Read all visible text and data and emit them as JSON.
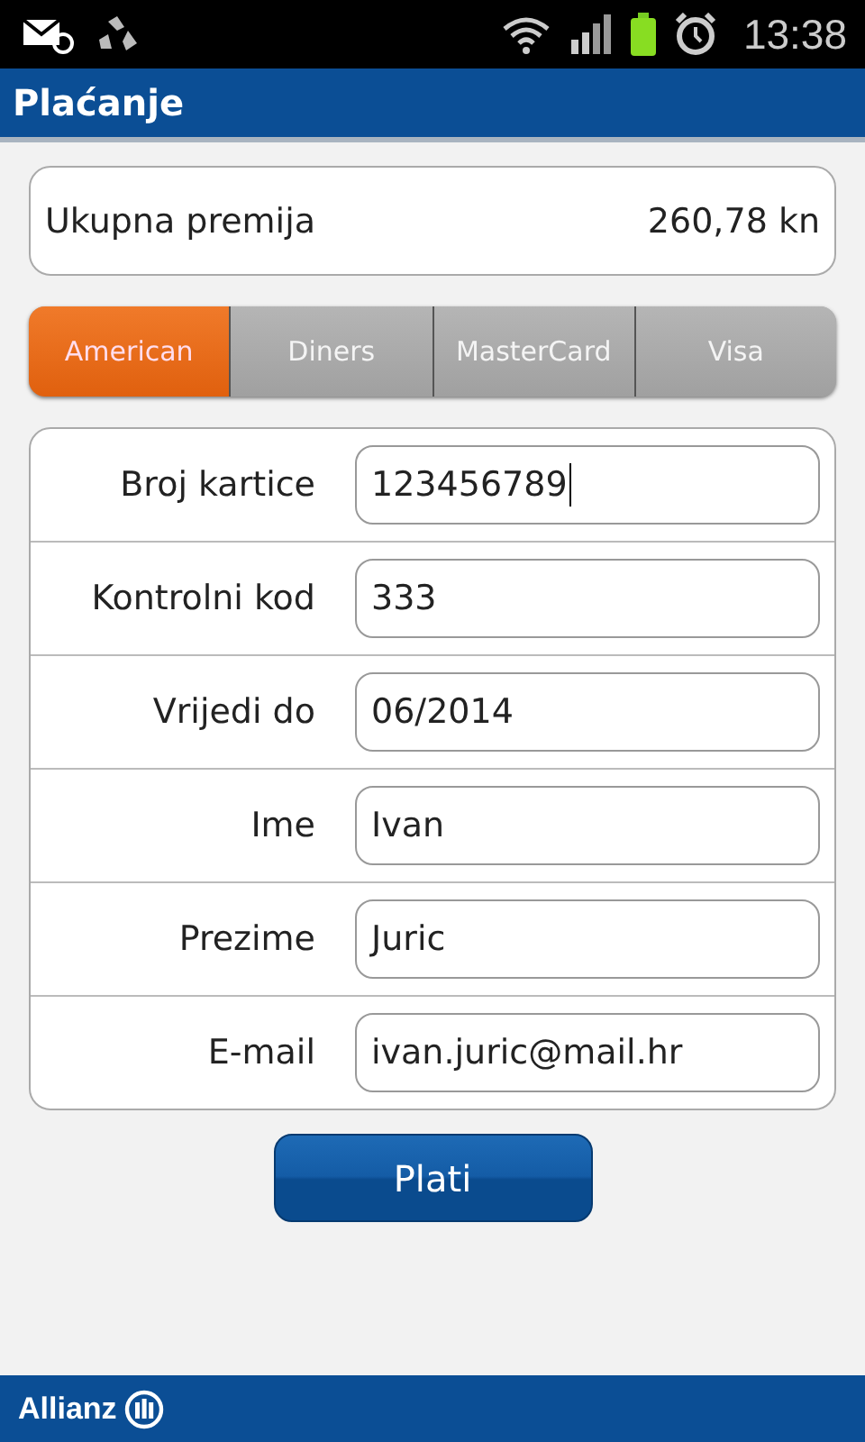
{
  "status_bar": {
    "time": "13:38"
  },
  "title_bar": {
    "title": "Plaćanje"
  },
  "total": {
    "label": "Ukupna premija",
    "amount": "260,78 kn"
  },
  "card_tabs": [
    {
      "label": "American",
      "selected": true
    },
    {
      "label": "Diners",
      "selected": false
    },
    {
      "label": "MasterCard",
      "selected": false
    },
    {
      "label": "Visa",
      "selected": false
    }
  ],
  "form_rows": [
    {
      "label": "Broj kartice",
      "value": "123456789",
      "focused": true
    },
    {
      "label": "Kontrolni kod",
      "value": "333",
      "focused": false
    },
    {
      "label": "Vrijedi do",
      "value": "06/2014",
      "focused": false
    },
    {
      "label": "Ime",
      "value": "Ivan",
      "focused": false
    },
    {
      "label": "Prezime",
      "value": "Juric",
      "focused": false
    },
    {
      "label": "E-mail",
      "value": "ivan.juric@mail.hr",
      "focused": false
    }
  ],
  "pay_button": "Plati",
  "footer": {
    "brand": "Allianz"
  }
}
